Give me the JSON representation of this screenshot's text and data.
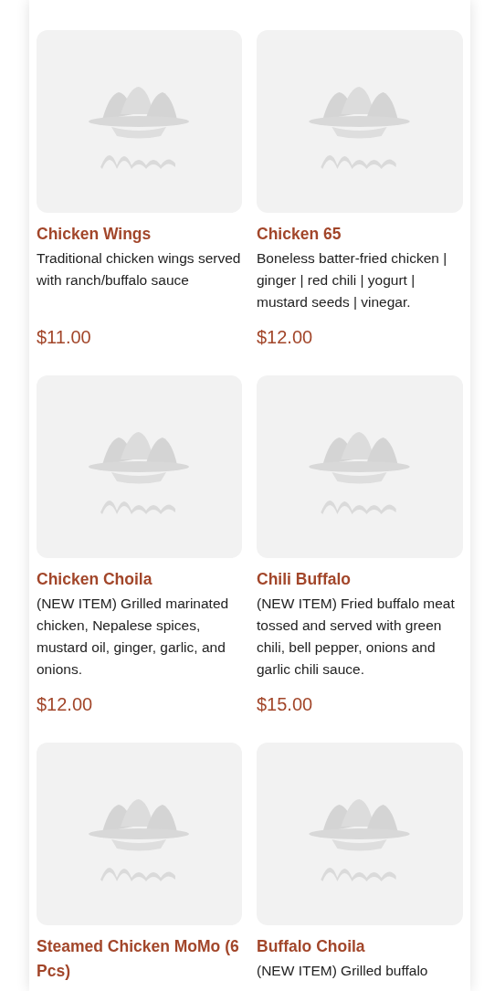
{
  "menu_items": [
    {
      "name": "Chicken Wings",
      "description": "Traditional chicken wings served with ranch/buffalo sauce",
      "price": "$11.00"
    },
    {
      "name": "Chicken 65",
      "description": "Boneless batter-fried chicken | ginger | red chili | yogurt | mustard seeds | vinegar.",
      "price": "$12.00"
    },
    {
      "name": "Chicken Choila",
      "description": "(NEW ITEM) Grilled marinated chicken, Nepalese spices, mustard oil, ginger, garlic, and onions.",
      "price": "$12.00"
    },
    {
      "name": "Chili Buffalo",
      "description": "(NEW ITEM) Fried buffalo meat tossed and served with green chili, bell pepper, onions and garlic chili sauce.",
      "price": "$15.00"
    },
    {
      "name": "Steamed Chicken MoMo (6 Pcs)"
    },
    {
      "name": "Buffalo Choila",
      "description": "(NEW ITEM) Grilled buffalo"
    }
  ]
}
